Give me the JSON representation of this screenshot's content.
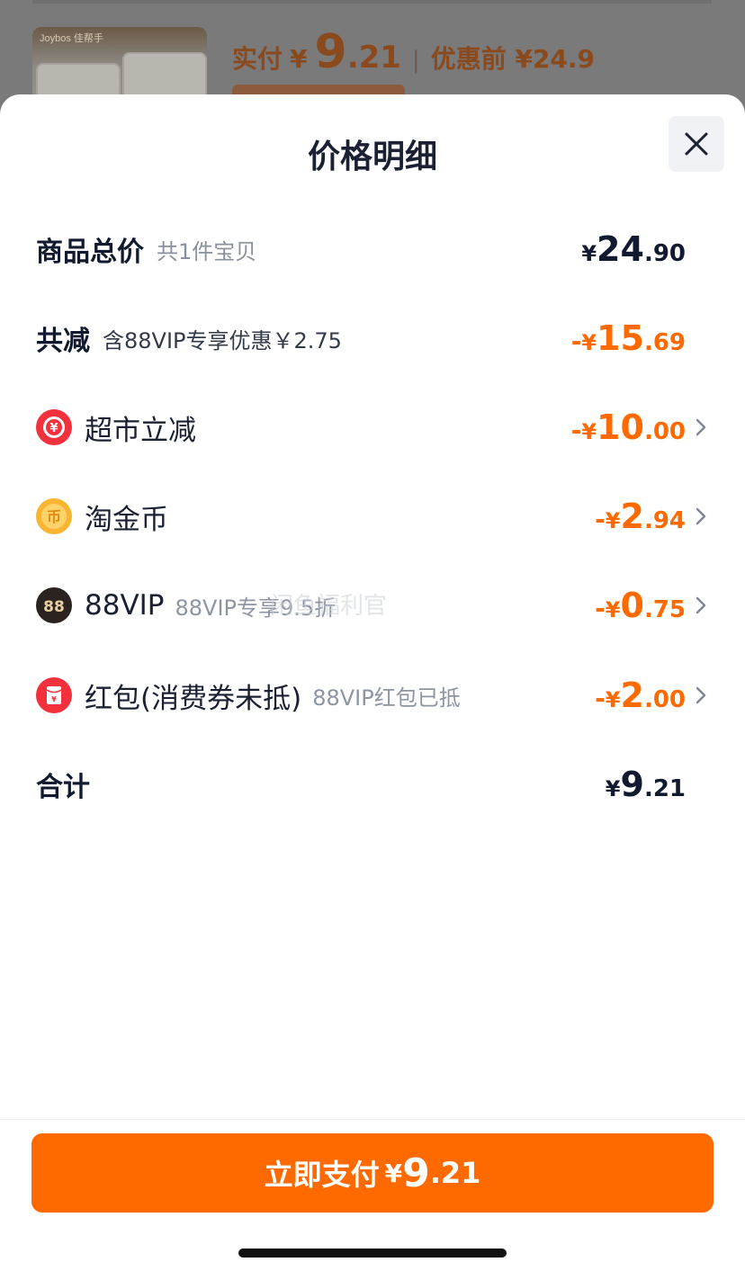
{
  "background": {
    "brand_text": "Joybos 佳帮手",
    "paid_label": "实付",
    "paid_yen": "¥",
    "paid_int": "9",
    "paid_dec": ".21",
    "separator": "|",
    "before_label": "优惠前 ¥24.9"
  },
  "sheet": {
    "title": "价格明细",
    "close_icon": "close-icon"
  },
  "rows": {
    "total": {
      "label": "商品总价",
      "sub": "共1件宝贝",
      "yen": "¥",
      "int": "24",
      "dec": ".90"
    },
    "reduce": {
      "label": "共减",
      "sub": "含88VIP专享优惠￥2.75",
      "sign": "-",
      "yen": "¥",
      "int": "15",
      "dec": ".69"
    },
    "supermarket": {
      "icon": "supermarket-discount-icon",
      "icon_glyph": "¥",
      "label": "超市立减",
      "sign": "-",
      "yen": "¥",
      "int": "10",
      "dec": ".00"
    },
    "coins": {
      "icon": "gold-coin-icon",
      "icon_glyph": "币",
      "label": "淘金币",
      "sign": "-",
      "yen": "¥",
      "int": "2",
      "dec": ".94"
    },
    "vip": {
      "icon": "88vip-icon",
      "icon_glyph": "88",
      "label": "88VIP",
      "sub": "88VIP专享9.5折",
      "sign": "-",
      "yen": "¥",
      "int": "0",
      "dec": ".75"
    },
    "redpacket": {
      "icon": "red-packet-icon",
      "icon_glyph": "¥",
      "label": "红包(消费券未抵)",
      "sub": "88VIP红包已抵",
      "sign": "-",
      "yen": "¥",
      "int": "2",
      "dec": ".00"
    },
    "sum": {
      "label": "合计",
      "yen": "¥",
      "int": "9",
      "dec": ".21"
    }
  },
  "watermark": "闲鱼福利官",
  "footer": {
    "pay_label": "立即支付",
    "yen": "¥",
    "int": "9",
    "dec": ".21"
  },
  "colors": {
    "accent": "#ff6a00",
    "text_dark": "#111a2e",
    "text_gray": "#8a909c",
    "supermarket_icon": "#f2313d",
    "coin_icon": "#f7b531",
    "vip_icon": "#2b2320",
    "redpacket_icon": "#f2313d"
  }
}
